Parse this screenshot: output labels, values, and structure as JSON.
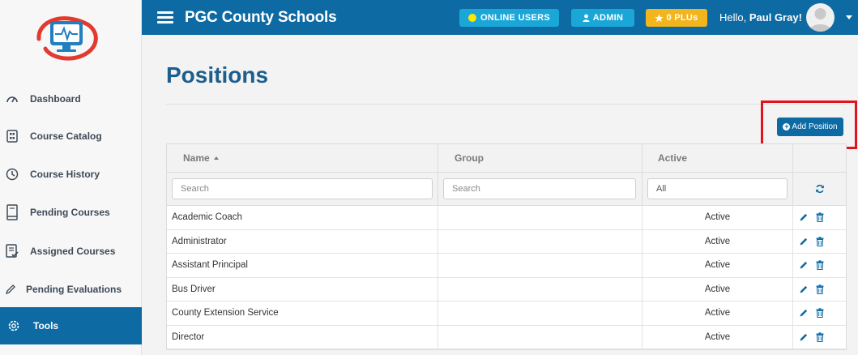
{
  "app": {
    "title": "PGC County Schools"
  },
  "header": {
    "online_users_label": "ONLINE USERS",
    "admin_label": "ADMIN",
    "plus_label": "0 PLUs",
    "hello_prefix": "Hello,",
    "user_name": "Paul Gray!"
  },
  "sidebar": {
    "items": [
      {
        "label": "Dashboard",
        "icon": "gauge-icon"
      },
      {
        "label": "Course Catalog",
        "icon": "catalog-icon"
      },
      {
        "label": "Course History",
        "icon": "clock-icon"
      },
      {
        "label": "Pending Courses",
        "icon": "book-icon"
      },
      {
        "label": "Assigned Courses",
        "icon": "checklist-icon"
      },
      {
        "label": "Pending Evaluations",
        "icon": "pencil-icon"
      },
      {
        "label": "Tools",
        "icon": "gear-icon",
        "active": true
      }
    ]
  },
  "page": {
    "title": "Positions",
    "add_button_label": "Add Position"
  },
  "table": {
    "columns": [
      "Name",
      "Group",
      "Active"
    ],
    "filters": {
      "name_placeholder": "Search",
      "group_placeholder": "Search",
      "active_value": "All"
    },
    "rows": [
      {
        "name": "Academic Coach",
        "group": "",
        "active": "Active"
      },
      {
        "name": "Administrator",
        "group": "",
        "active": "Active"
      },
      {
        "name": "Assistant Principal",
        "group": "",
        "active": "Active"
      },
      {
        "name": "Bus Driver",
        "group": "",
        "active": "Active"
      },
      {
        "name": "County Extension Service",
        "group": "",
        "active": "Active"
      },
      {
        "name": "Director",
        "group": "",
        "active": "Active"
      }
    ]
  },
  "colors": {
    "primary": "#0e6aa3",
    "accent_cyan": "#1aa7d8",
    "accent_gold": "#f2b51c",
    "highlight_red": "#e0141e"
  }
}
